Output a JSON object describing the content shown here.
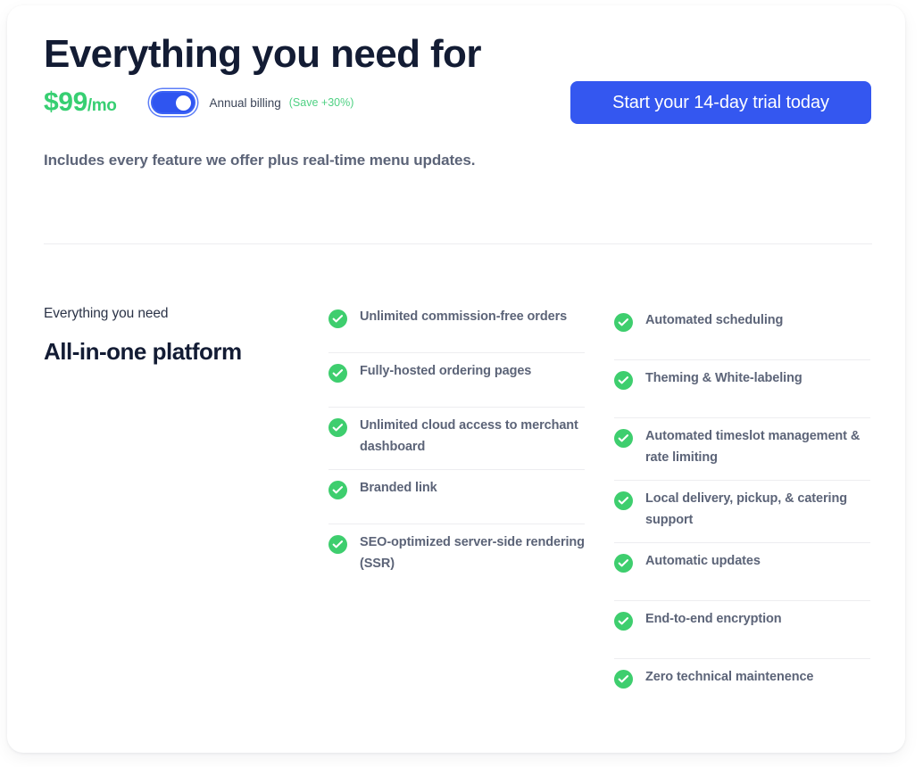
{
  "hero": {
    "title": "Everything you need for",
    "price": "$99",
    "price_period": "/mo",
    "toggle_label": "Annual billing",
    "save_badge": "(Save +30%)",
    "toggle_state": "on",
    "cta_label": "Start your 14-day trial today",
    "subtitle": "Includes every feature we offer plus real-time menu updates."
  },
  "intro": {
    "eyebrow": "Everything you need",
    "heading": "All-in-one platform"
  },
  "features": {
    "check_icon": "check-circle-icon",
    "column_left": [
      {
        "label": "Unlimited commission-free orders"
      },
      {
        "label": "Fully-hosted ordering pages"
      },
      {
        "label": "Unlimited cloud access to merchant dashboard"
      },
      {
        "label": "Branded link"
      },
      {
        "label": "SEO-optimized server-side rendering (SSR)"
      }
    ],
    "column_right": [
      {
        "label": "Automated scheduling"
      },
      {
        "label": "Theming & White-labeling"
      },
      {
        "label": "Automated timeslot management & rate limiting"
      },
      {
        "label": "Local delivery, pickup, & catering support"
      },
      {
        "label": "Automatic updates"
      },
      {
        "label": "End-to-end encryption"
      },
      {
        "label": "Zero technical maintenence"
      }
    ]
  },
  "colors": {
    "accent_blue": "#3457f0",
    "accent_green": "#3ece6e",
    "price_green": "#37cf72",
    "heading_dark": "#131c34",
    "body_gray": "#5c6478",
    "divider": "#ededf0"
  }
}
